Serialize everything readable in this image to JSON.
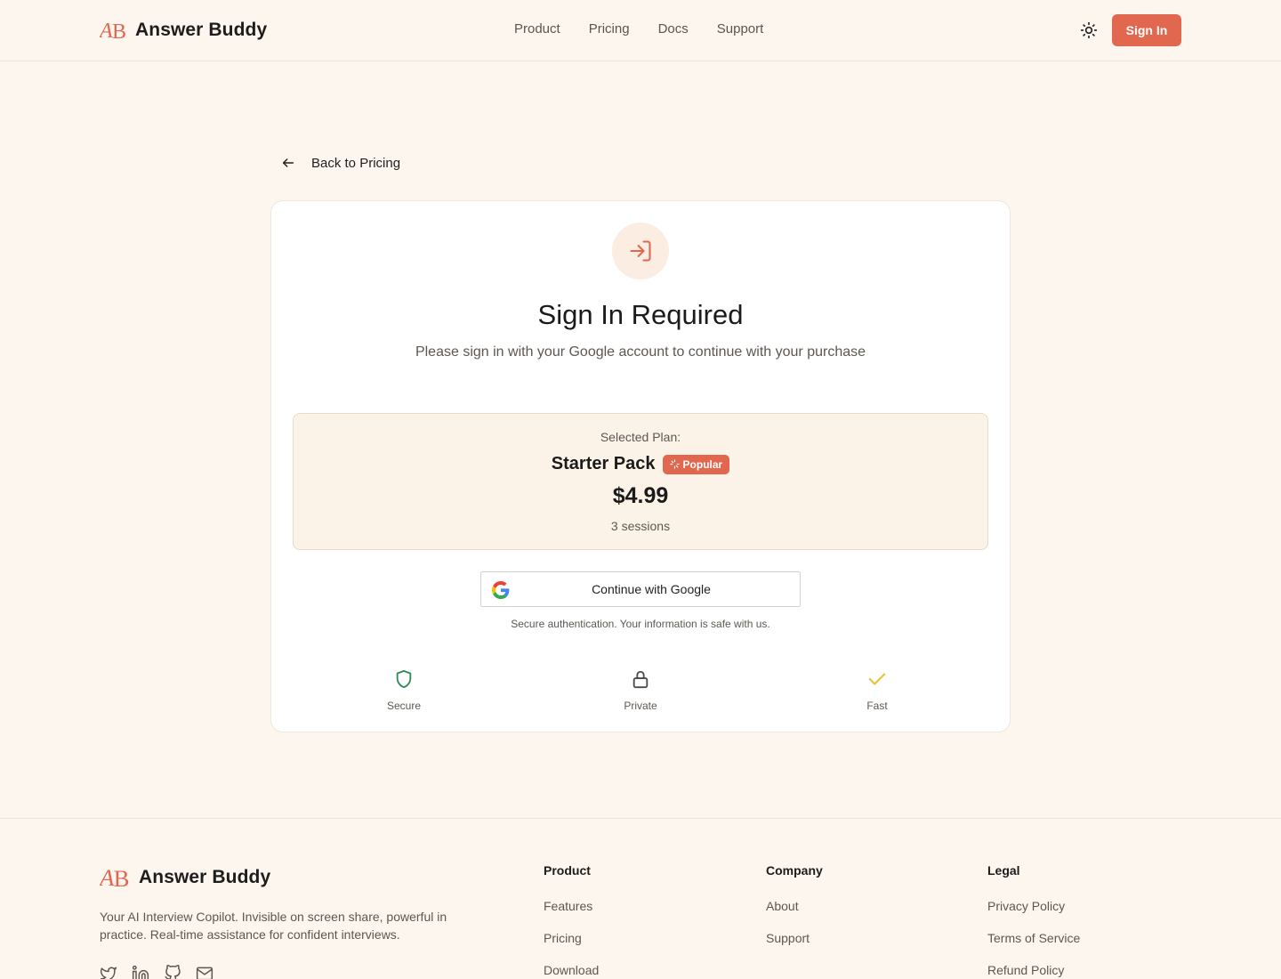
{
  "header": {
    "brand_mark": "AB",
    "brand_name": "Answer Buddy",
    "nav": [
      "Product",
      "Pricing",
      "Docs",
      "Support"
    ],
    "sign_in_label": "Sign In"
  },
  "back": {
    "label": "Back to Pricing"
  },
  "card": {
    "title": "Sign In Required",
    "subtitle": "Please sign in with your Google account to continue with your purchase",
    "plan": {
      "label": "Selected Plan:",
      "name": "Starter Pack",
      "badge": "Popular",
      "price": "$4.99",
      "sessions": "3 sessions"
    },
    "google_button": "Continue with Google",
    "secure_note": "Secure authentication. Your information is safe with us.",
    "features": [
      {
        "label": "Secure",
        "icon": "shield-icon",
        "color": "#2e8b57"
      },
      {
        "label": "Private",
        "icon": "lock-icon",
        "color": "#4a4a4a"
      },
      {
        "label": "Fast",
        "icon": "check-icon",
        "color": "#e8c32e"
      }
    ]
  },
  "footer": {
    "brand_name": "Answer Buddy",
    "description": "Your AI Interview Copilot. Invisible on screen share, powerful in practice. Real-time assistance for confident interviews.",
    "social": [
      "twitter-icon",
      "linkedin-icon",
      "github-icon",
      "mail-icon"
    ],
    "columns": [
      {
        "title": "Product",
        "links": [
          "Features",
          "Pricing",
          "Download"
        ]
      },
      {
        "title": "Company",
        "links": [
          "About",
          "Support"
        ]
      },
      {
        "title": "Legal",
        "links": [
          "Privacy Policy",
          "Terms of Service",
          "Refund Policy"
        ]
      }
    ]
  },
  "colors": {
    "accent": "#e2674f",
    "background": "#fdf6ee",
    "plan_box": "#fcf3e8"
  }
}
